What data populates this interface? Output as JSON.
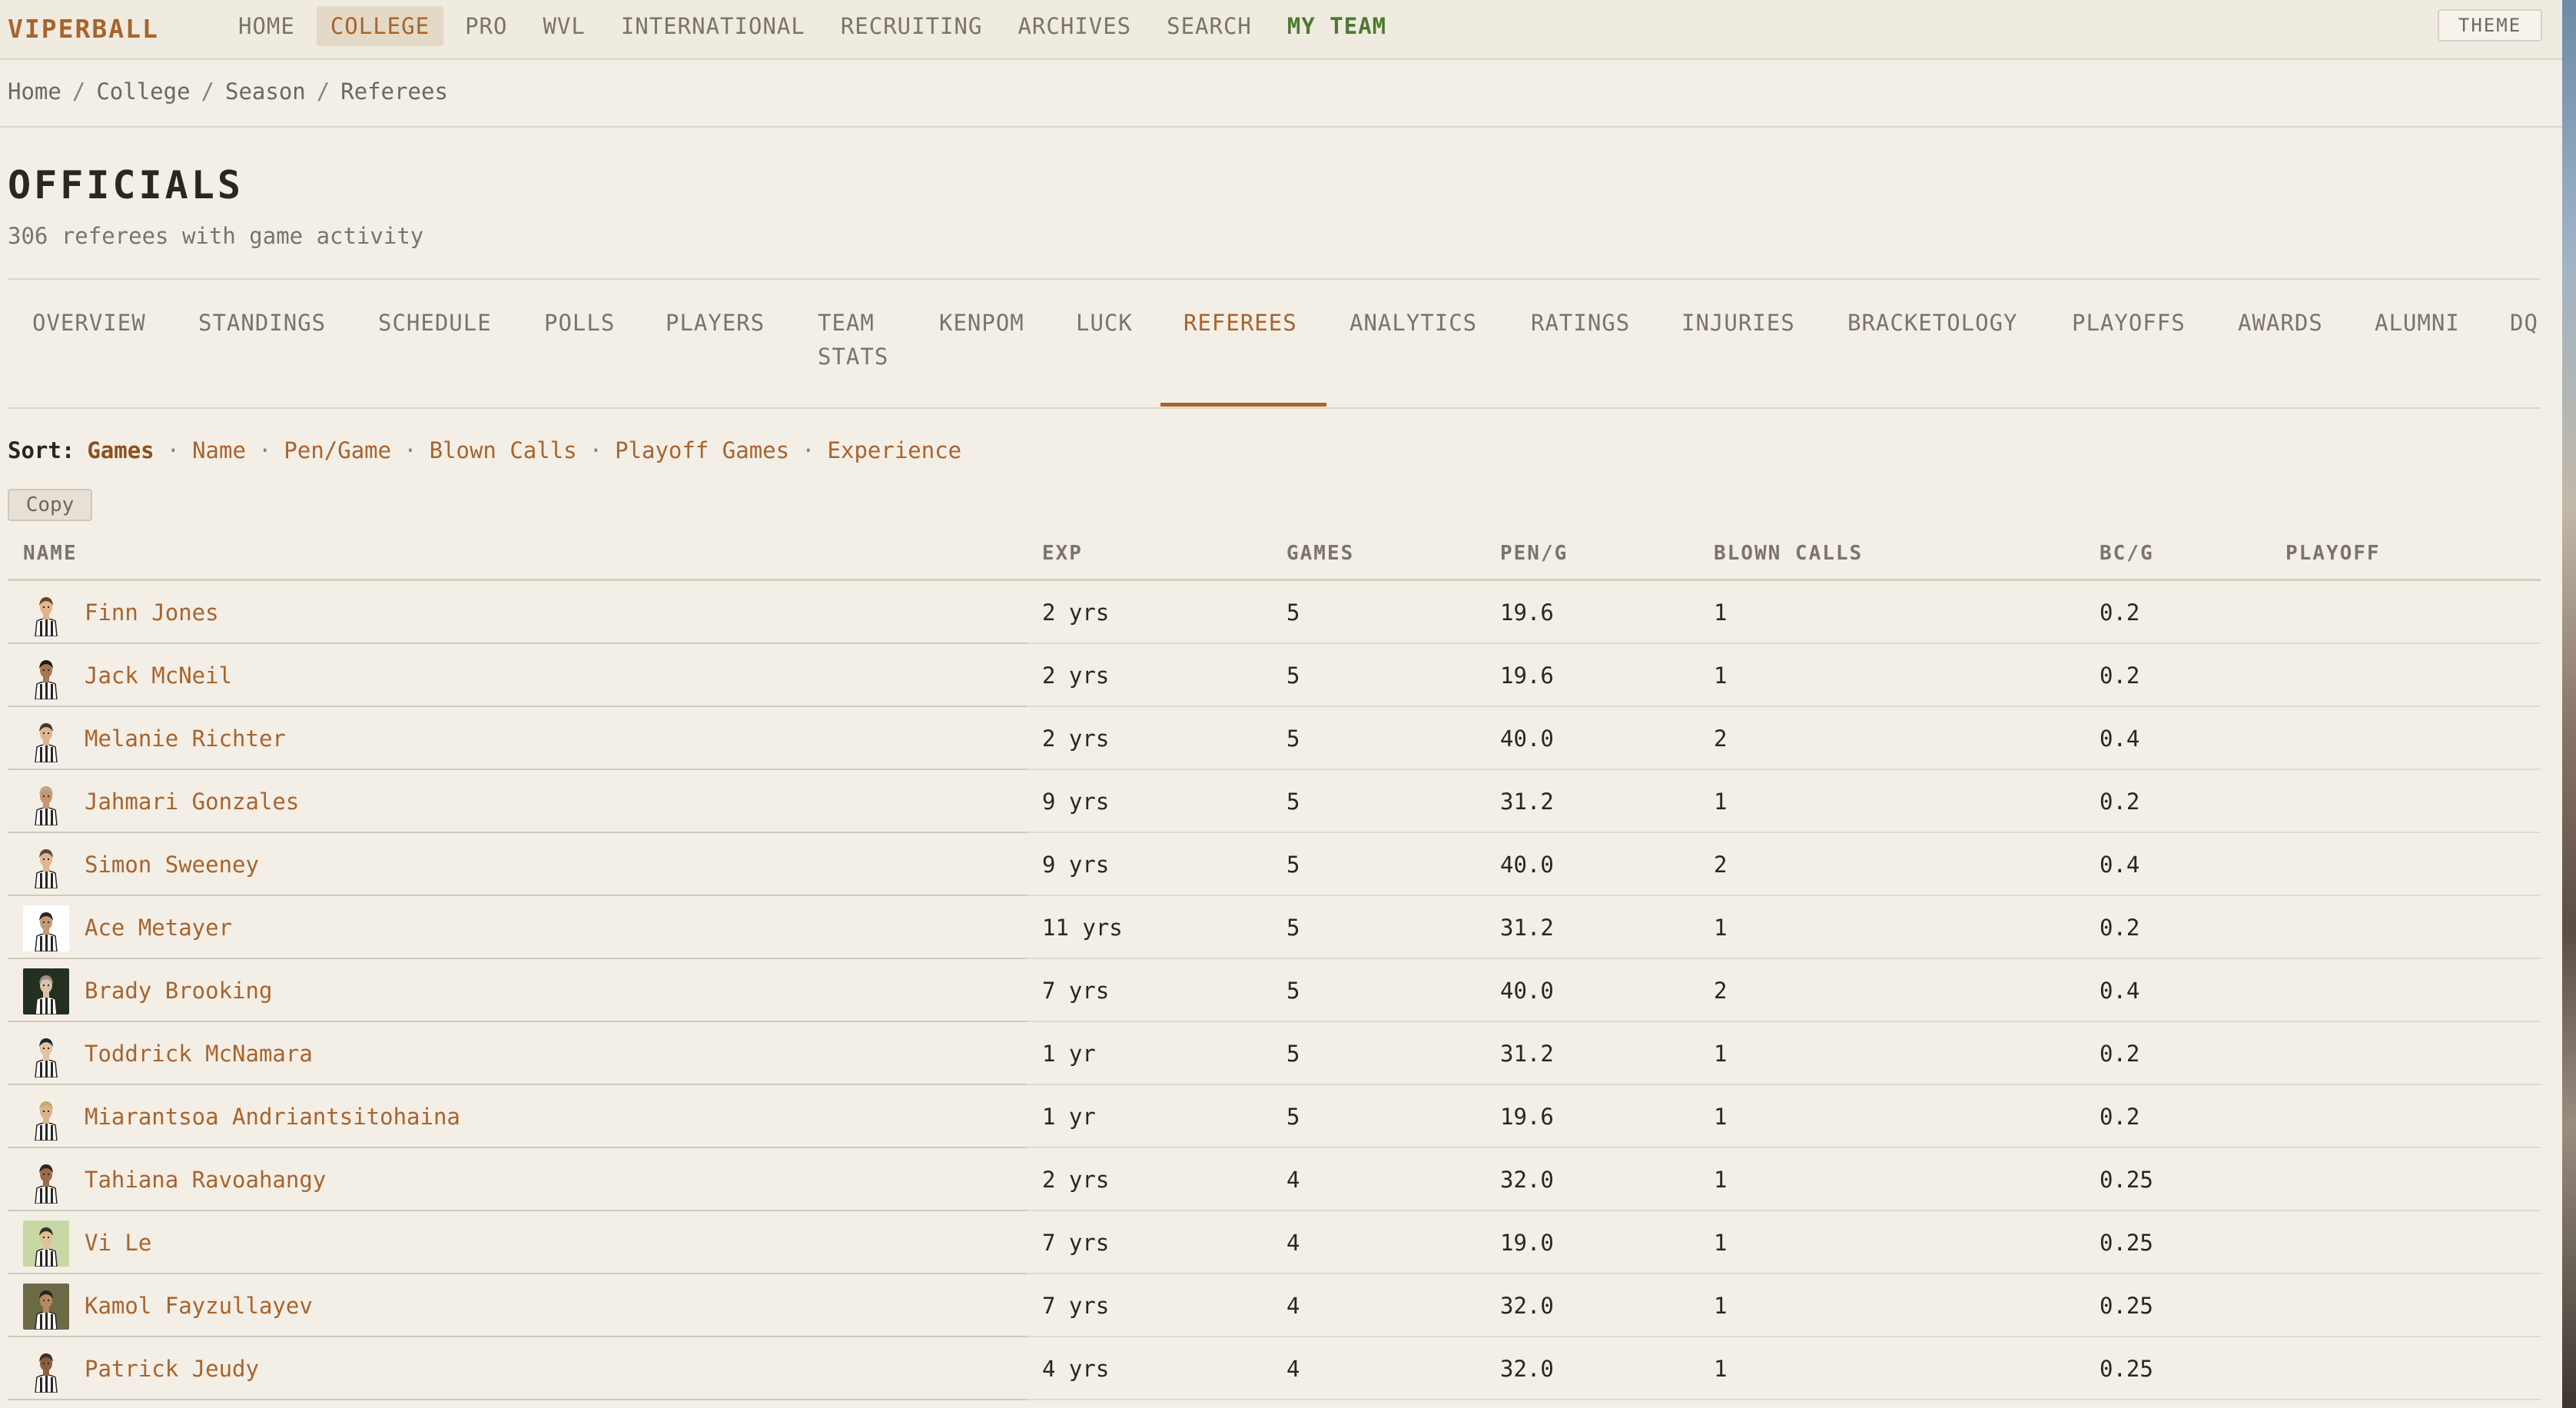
{
  "nav": {
    "brand": "VIPERBALL",
    "links": [
      "HOME",
      "COLLEGE",
      "PRO",
      "WVL",
      "INTERNATIONAL",
      "RECRUITING",
      "ARCHIVES",
      "SEARCH",
      "MY TEAM"
    ],
    "theme_label": "THEME"
  },
  "breadcrumb": [
    "Home",
    "College",
    "Season",
    "Referees"
  ],
  "header": {
    "title": "OFFICIALS",
    "subtitle": "306 referees with game activity"
  },
  "tabs": [
    "OVERVIEW",
    "STANDINGS",
    "SCHEDULE",
    "POLLS",
    "PLAYERS",
    "TEAM\nSTATS",
    "KENPOM",
    "LUCK",
    "REFEREES",
    "ANALYTICS",
    "RATINGS",
    "INJURIES",
    "BRACKETOLOGY",
    "PLAYOFFS",
    "AWARDS",
    "ALUMNI",
    "DQ"
  ],
  "active_tab": "REFEREES",
  "sort": {
    "label": "Sort:",
    "options": [
      "Games",
      "Name",
      "Pen/Game",
      "Blown Calls",
      "Playoff Games",
      "Experience"
    ],
    "active": "Games"
  },
  "copy_label": "Copy",
  "table": {
    "columns": [
      "NAME",
      "EXP",
      "GAMES",
      "PEN/G",
      "BLOWN CALLS",
      "BC/G",
      "PLAYOFF"
    ],
    "rows": [
      {
        "name": "Finn Jones",
        "exp": "2 yrs",
        "games": "5",
        "pen_g": "19.6",
        "blown": "1",
        "bc_g": "0.2",
        "playoff": "",
        "avatar": {
          "bg": "#f3efe7",
          "skin": "#e2b489",
          "hair": "#6b4424"
        }
      },
      {
        "name": "Jack McNeil",
        "exp": "2 yrs",
        "games": "5",
        "pen_g": "19.6",
        "blown": "1",
        "bc_g": "0.2",
        "playoff": "",
        "avatar": {
          "bg": "#f3efe7",
          "skin": "#a8764f",
          "hair": "#1f1a17"
        }
      },
      {
        "name": "Melanie Richter",
        "exp": "2 yrs",
        "games": "5",
        "pen_g": "40.0",
        "blown": "2",
        "bc_g": "0.4",
        "playoff": "",
        "avatar": {
          "bg": "#f3efe7",
          "skin": "#e0b58e",
          "hair": "#3c3a33"
        }
      },
      {
        "name": "Jahmari Gonzales",
        "exp": "9 yrs",
        "games": "5",
        "pen_g": "31.2",
        "blown": "1",
        "bc_g": "0.2",
        "playoff": "",
        "avatar": {
          "bg": "#f3efe7",
          "skin": "#c99470",
          "hair": "#b9a98c"
        }
      },
      {
        "name": "Simon Sweeney",
        "exp": "9 yrs",
        "games": "5",
        "pen_g": "40.0",
        "blown": "2",
        "bc_g": "0.4",
        "playoff": "",
        "avatar": {
          "bg": "#f3efe7",
          "skin": "#e1b592",
          "hair": "#58493a"
        }
      },
      {
        "name": "Ace Metayer",
        "exp": "11 yrs",
        "games": "5",
        "pen_g": "31.2",
        "blown": "1",
        "bc_g": "0.2",
        "playoff": "",
        "avatar": {
          "bg": "#ffffff",
          "skin": "#c79a76",
          "hair": "#2b2522"
        }
      },
      {
        "name": "Brady Brooking",
        "exp": "7 yrs",
        "games": "5",
        "pen_g": "40.0",
        "blown": "2",
        "bc_g": "0.4",
        "playoff": "",
        "avatar": {
          "bg": "#24301f",
          "skin": "#d9c2a8",
          "hair": "#9a8f88"
        }
      },
      {
        "name": "Toddrick McNamara",
        "exp": "1 yr",
        "games": "5",
        "pen_g": "31.2",
        "blown": "1",
        "bc_g": "0.2",
        "playoff": "",
        "avatar": {
          "bg": "#f3efe7",
          "skin": "#e3c2a3",
          "hair": "#1d2833"
        }
      },
      {
        "name": "Miarantsoa Andriantsitohaina",
        "exp": "1 yr",
        "games": "5",
        "pen_g": "19.6",
        "blown": "1",
        "bc_g": "0.2",
        "playoff": "",
        "avatar": {
          "bg": "#f3efe7",
          "skin": "#d8b489",
          "hair": "#c9a86b"
        }
      },
      {
        "name": "Tahiana Ravoahangy",
        "exp": "2 yrs",
        "games": "4",
        "pen_g": "32.0",
        "blown": "1",
        "bc_g": "0.25",
        "playoff": "",
        "avatar": {
          "bg": "#f3efe7",
          "skin": "#9c6c47",
          "hair": "#2e2520"
        }
      },
      {
        "name": "Vi Le",
        "exp": "7 yrs",
        "games": "4",
        "pen_g": "19.0",
        "blown": "1",
        "bc_g": "0.25",
        "playoff": "",
        "avatar": {
          "bg": "#c8d8a4",
          "skin": "#e2bf96",
          "hair": "#3b3128"
        }
      },
      {
        "name": "Kamol Fayzullayev",
        "exp": "7 yrs",
        "games": "4",
        "pen_g": "32.0",
        "blown": "1",
        "bc_g": "0.25",
        "playoff": "",
        "avatar": {
          "bg": "#6b6a45",
          "skin": "#b98761",
          "hair": "#2a211b"
        }
      },
      {
        "name": "Patrick Jeudy",
        "exp": "4 yrs",
        "games": "4",
        "pen_g": "32.0",
        "blown": "1",
        "bc_g": "0.25",
        "playoff": "",
        "avatar": {
          "bg": "#f3efe7",
          "skin": "#8a5f3e",
          "hair": "#3d2f24"
        }
      }
    ]
  },
  "colors": {
    "accent": "#a8642c",
    "my_team": "#4d7a2f",
    "background": "#f3efe7"
  }
}
